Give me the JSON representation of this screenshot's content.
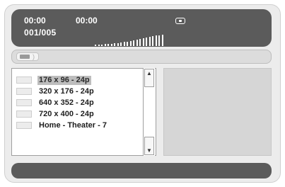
{
  "status": {
    "time_elapsed": "00:00",
    "time_total": "00:00",
    "track_counter": "001/005",
    "record_icon": "record-indicator-icon",
    "level_meter_icon": "audio-level-meter-icon"
  },
  "crumb": {
    "folder_icon": "folder-icon",
    "label": ")"
  },
  "list": {
    "items": [
      {
        "label": "176 x 96 - 24p",
        "selected": true
      },
      {
        "label": "320 x 176 - 24p",
        "selected": false
      },
      {
        "label": "640 x 352 - 24p",
        "selected": false
      },
      {
        "label": "720 x 400 - 24p",
        "selected": false
      },
      {
        "label": "Home - Theater - 7",
        "selected": false
      }
    ],
    "scroll_up_icon": "scroll-up-arrow-icon",
    "scroll_down_icon": "scroll-down-arrow-icon"
  },
  "colors": {
    "dark_bar": "#5b5b5b",
    "panel_bg": "#ececec",
    "selection": "#bdbdbd",
    "preview_bg": "#d6d6d6"
  }
}
